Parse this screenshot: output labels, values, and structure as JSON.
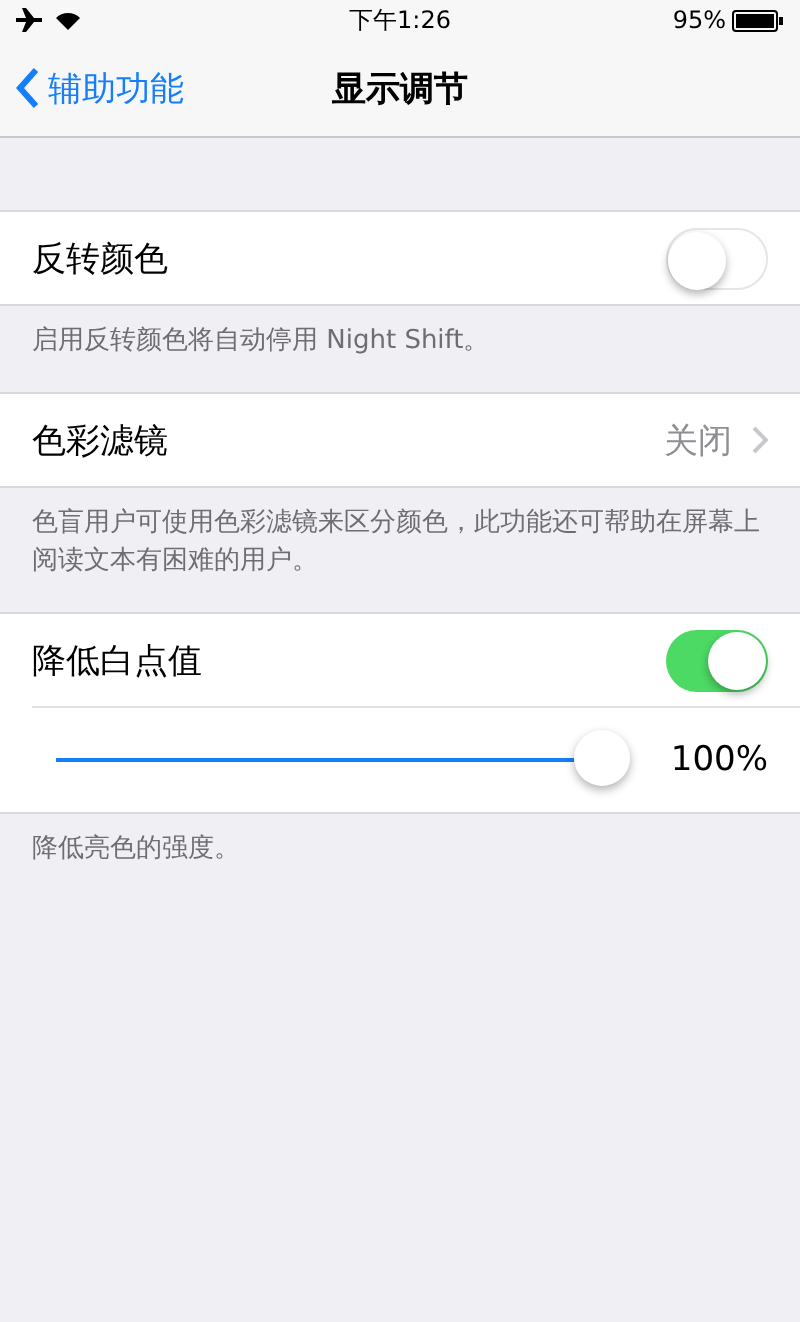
{
  "status_bar": {
    "time": "下午1:26",
    "battery": "95%"
  },
  "nav": {
    "back": "辅助功能",
    "title": "显示调节"
  },
  "sections": [
    {
      "rows": [
        {
          "kind": "toggle",
          "label": "反转颜色",
          "on": false
        }
      ],
      "footer": "启用反转颜色将自动停用 Night Shift。"
    },
    {
      "rows": [
        {
          "kind": "link",
          "label": "色彩滤镜",
          "value": "关闭"
        }
      ],
      "footer": "色盲用户可使用色彩滤镜来区分颜色，此功能还可帮助在屏幕上阅读文本有困难的用户。"
    },
    {
      "rows": [
        {
          "kind": "toggle",
          "label": "降低白点值",
          "on": true
        },
        {
          "kind": "slider",
          "level": 1,
          "reading": "100%"
        }
      ],
      "footer": "降低亮色的强度。"
    }
  ]
}
